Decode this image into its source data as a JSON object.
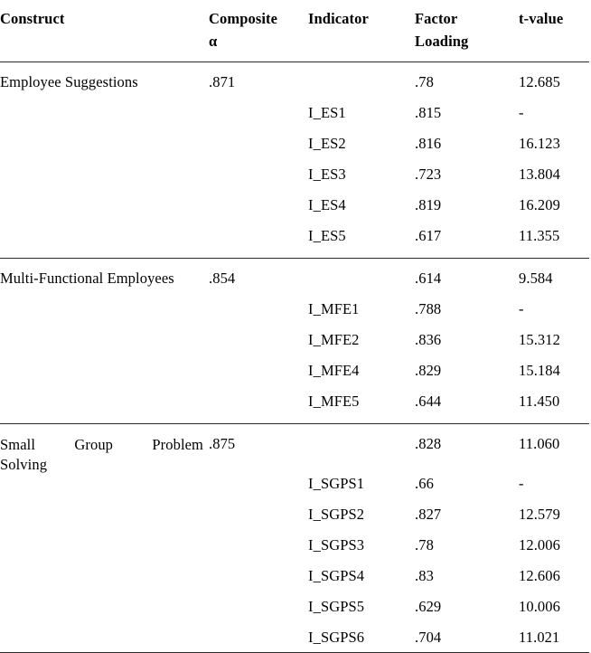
{
  "table": {
    "columns": [
      {
        "key": "construct",
        "label": "Construct"
      },
      {
        "key": "composite_alpha",
        "label": "Composite",
        "label_line2": "α"
      },
      {
        "key": "indicator",
        "label": "Indicator"
      },
      {
        "key": "factor_loading",
        "label": "Factor",
        "label_line2": "Loading"
      },
      {
        "key": "t_value",
        "label": "t-value"
      }
    ],
    "blocks": [
      {
        "construct": "Employee Suggestions",
        "composite_alpha": ".871",
        "summary": {
          "factor_loading": ".78",
          "t_value": "12.685"
        },
        "rows": [
          {
            "indicator": "I_ES1",
            "factor_loading": ".815",
            "t_value": "-"
          },
          {
            "indicator": "I_ES2",
            "factor_loading": ".816",
            "t_value": "16.123"
          },
          {
            "indicator": "I_ES3",
            "factor_loading": ".723",
            "t_value": "13.804"
          },
          {
            "indicator": "I_ES4",
            "factor_loading": ".819",
            "t_value": "16.209"
          },
          {
            "indicator": "I_ES5",
            "factor_loading": ".617",
            "t_value": "11.355"
          }
        ]
      },
      {
        "construct": "Multi-Functional Employees",
        "composite_alpha": ".854",
        "summary": {
          "factor_loading": ".614",
          "t_value": "9.584"
        },
        "rows": [
          {
            "indicator": "I_MFE1",
            "factor_loading": ".788",
            "t_value": "-"
          },
          {
            "indicator": "I_MFE2",
            "factor_loading": ".836",
            "t_value": "15.312"
          },
          {
            "indicator": "I_MFE4",
            "factor_loading": ".829",
            "t_value": "15.184"
          },
          {
            "indicator": "I_MFE5",
            "factor_loading": ".644",
            "t_value": "11.450"
          }
        ]
      },
      {
        "construct": "Small Group Problem Solving",
        "construct_line1": "Small Group Problem",
        "construct_line2": "Solving",
        "composite_alpha": ".875",
        "summary": {
          "factor_loading": ".828",
          "t_value": "11.060"
        },
        "rows": [
          {
            "indicator": "I_SGPS1",
            "factor_loading": ".66",
            "t_value": "-"
          },
          {
            "indicator": "I_SGPS2",
            "factor_loading": ".827",
            "t_value": "12.579"
          },
          {
            "indicator": "I_SGPS3",
            "factor_loading": ".78",
            "t_value": "12.006"
          },
          {
            "indicator": "I_SGPS4",
            "factor_loading": ".83",
            "t_value": "12.606"
          },
          {
            "indicator": "I_SGPS5",
            "factor_loading": ".629",
            "t_value": "10.006"
          },
          {
            "indicator": "I_SGPS6",
            "factor_loading": ".704",
            "t_value": "11.021"
          }
        ]
      }
    ]
  }
}
